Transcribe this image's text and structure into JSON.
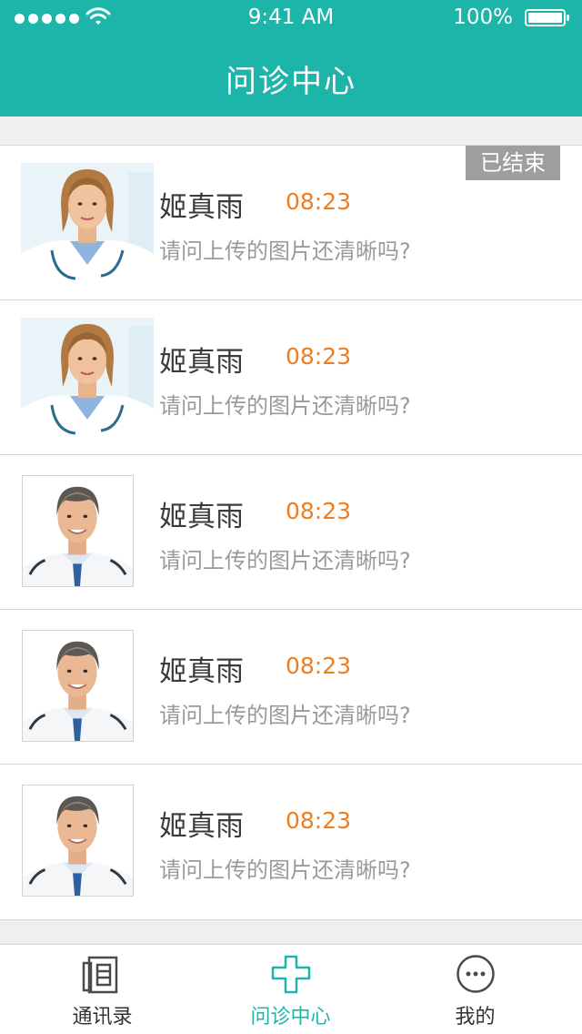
{
  "status_bar": {
    "time": "9:41 AM",
    "battery": "100%"
  },
  "header": {
    "title": "问诊中心"
  },
  "consultations": [
    {
      "name": "姬真雨",
      "time": "08:23",
      "message": "请问上传的图片还清晰吗?",
      "status": "已结束",
      "avatar": "female-doctor-avatar"
    },
    {
      "name": "姬真雨",
      "time": "08:23",
      "message": "请问上传的图片还清晰吗?",
      "avatar": "female-doctor-avatar"
    },
    {
      "name": "姬真雨",
      "time": "08:23",
      "message": "请问上传的图片还清晰吗?",
      "avatar": "male-doctor-avatar"
    },
    {
      "name": "姬真雨",
      "time": "08:23",
      "message": "请问上传的图片还清晰吗?",
      "avatar": "male-doctor-avatar"
    },
    {
      "name": "姬真雨",
      "time": "08:23",
      "message": "请问上传的图片还清晰吗?",
      "avatar": "male-doctor-avatar"
    }
  ],
  "tabbar": {
    "tabs": [
      {
        "label": "通讯录",
        "icon": "contacts-icon",
        "active": false
      },
      {
        "label": "问诊中心",
        "icon": "medical-cross-icon",
        "active": true
      },
      {
        "label": "我的",
        "icon": "more-circle-icon",
        "active": false
      }
    ]
  },
  "colors": {
    "primary": "#1db5aa",
    "time": "#f07d1d",
    "badge": "#9e9e9e"
  }
}
